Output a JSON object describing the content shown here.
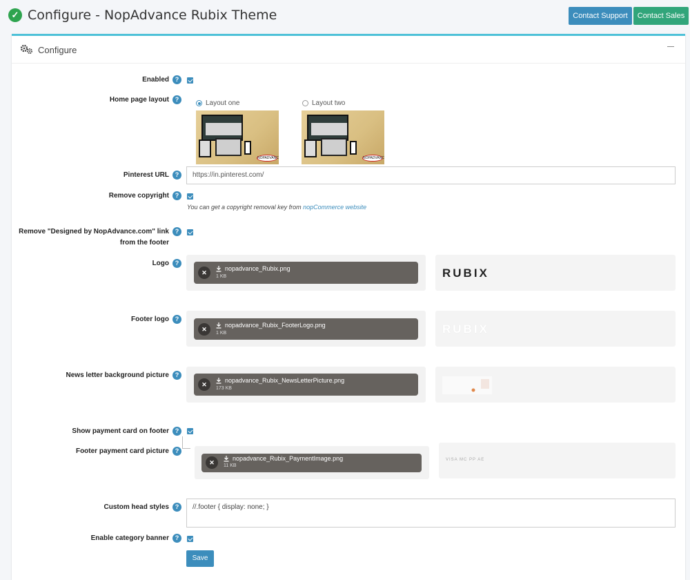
{
  "header": {
    "title": "Configure - NopAdvance Rubix Theme",
    "contact_support": "Contact Support",
    "contact_sales": "Contact Sales"
  },
  "card": {
    "title": "Configure"
  },
  "fields": {
    "enabled": {
      "label": "Enabled",
      "checked": true
    },
    "home_layout": {
      "label": "Home page layout",
      "options": [
        "Layout one",
        "Layout two"
      ],
      "selected": "Layout one",
      "badge_text": "NOPADVANCE"
    },
    "pinterest": {
      "label": "Pinterest URL",
      "value": "https://in.pinterest.com/"
    },
    "remove_copyright": {
      "label": "Remove copyright",
      "checked": true,
      "hint_text": "You can get a copyright removal key from",
      "hint_link": "nopCommerce website"
    },
    "remove_designed": {
      "label_line1": "Remove \"Designed by NopAdvance.com\" link",
      "label_line2": "from the footer",
      "checked": true
    },
    "logo": {
      "label": "Logo",
      "file": "nopadvance_Rubix.png",
      "size": "1 KB",
      "preview_text": "RUBIX"
    },
    "footer_logo": {
      "label": "Footer logo",
      "file": "nopadvance_Rubix_FooterLogo.png",
      "size": "1 KB",
      "preview_text": "RUBIX"
    },
    "newsletter": {
      "label": "News letter background picture",
      "file": "nopadvance_Rubix_NewsLetterPicture.png",
      "size": "173 KB"
    },
    "show_payment": {
      "label": "Show payment card on footer",
      "checked": true
    },
    "payment_picture": {
      "label": "Footer payment card picture",
      "file": "nopadvance_Rubix_PaymentImage.png",
      "size": "11 KB",
      "card_brands": [
        "VISA",
        "MC",
        "PP",
        "AE"
      ]
    },
    "custom_styles": {
      "label": "Custom head styles",
      "value": "//.footer { display: none; }"
    },
    "category_banner": {
      "label": "Enable category banner",
      "checked": true
    }
  },
  "save_label": "Save",
  "icons": {
    "title": "check-circle-icon",
    "header": "gears-icon",
    "collapse": "minus-icon",
    "help": "question-icon",
    "remove": "close-icon",
    "download": "download-icon"
  },
  "colors": {
    "primary": "#3c8dbc",
    "success": "#31a57a",
    "card_accent": "#4ec1d8",
    "file_chip": "#66625e"
  }
}
